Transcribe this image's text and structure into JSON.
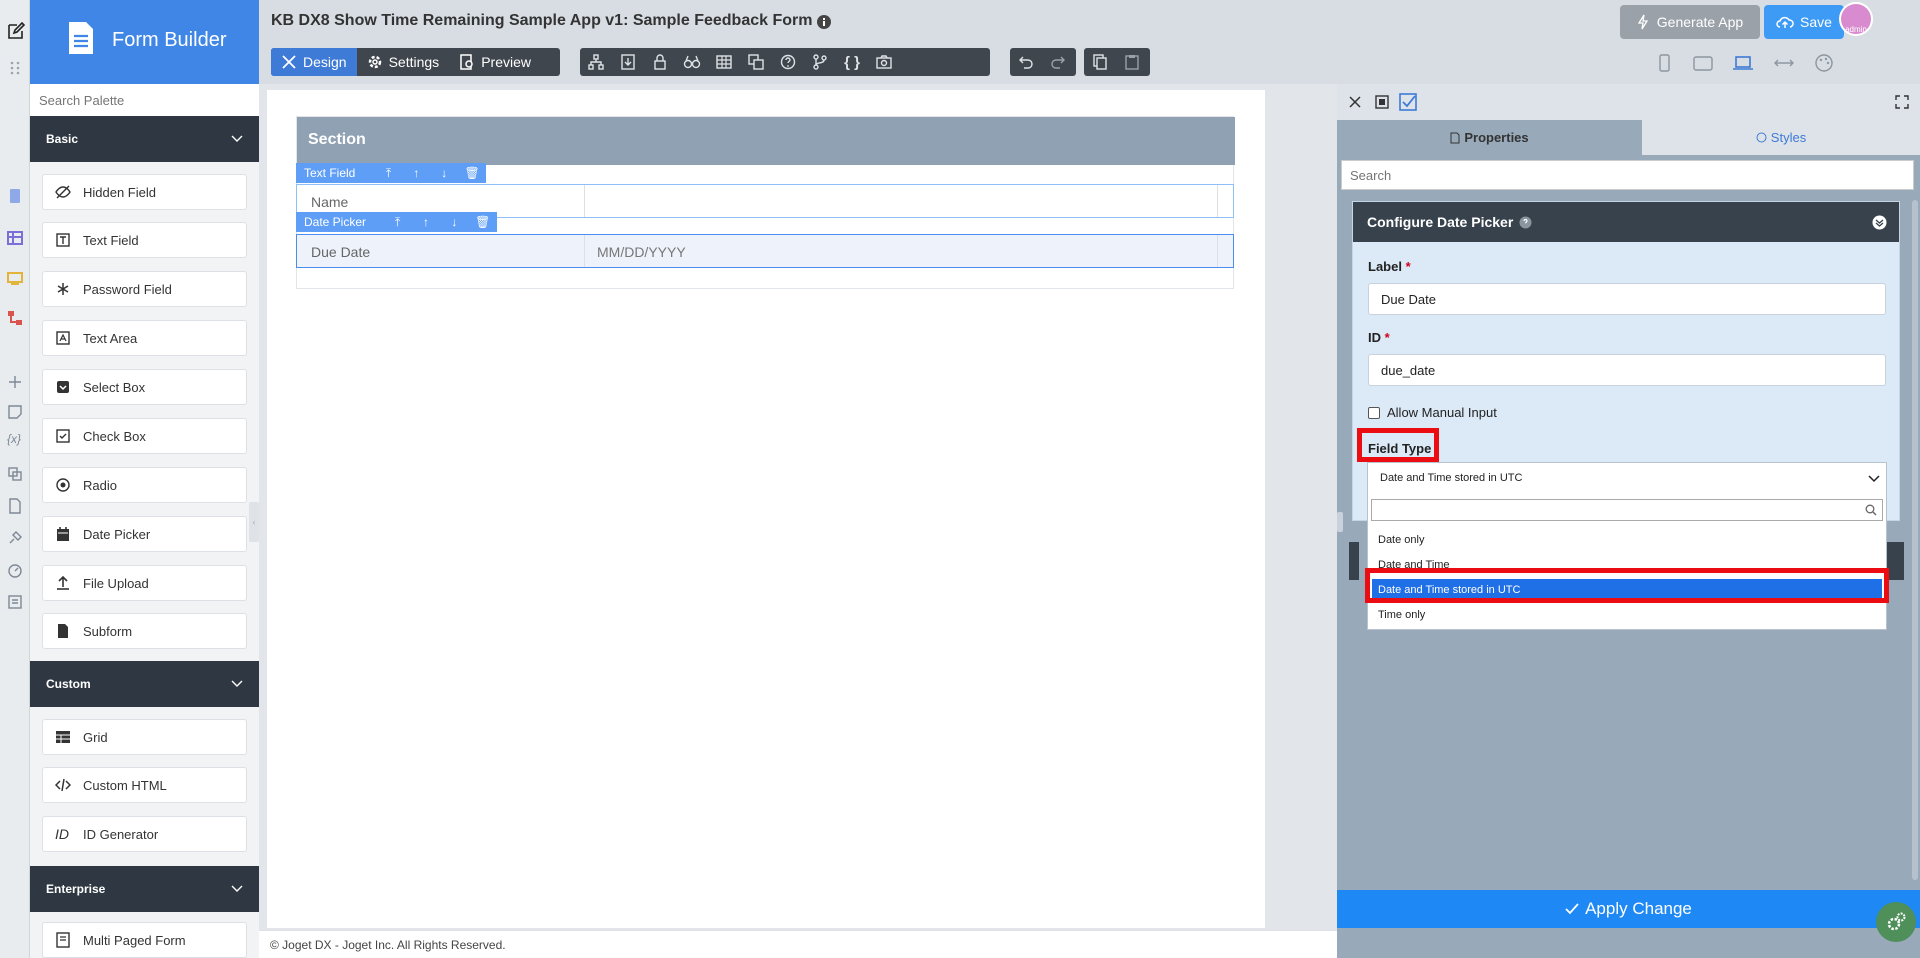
{
  "app": {
    "title": "KB DX8 Show Time Remaining Sample App v1: Sample Feedback Form",
    "builder_name": "Form Builder",
    "generate_app_label": "Generate App",
    "save_label": "Save",
    "avatar_text": "admin"
  },
  "toolbar": {
    "design_label": "Design",
    "settings_label": "Settings",
    "preview_label": "Preview",
    "tools": [
      "tree-icon",
      "import-icon",
      "lock-icon",
      "binoculars-icon",
      "table-icon",
      "translate-icon",
      "help-icon",
      "branch-icon",
      "code-icon",
      "camera-icon"
    ],
    "history": [
      "undo-icon",
      "redo-icon"
    ],
    "clipboard": [
      "copy-icon",
      "paste-icon"
    ],
    "devices": [
      "mobile-icon",
      "tablet-icon",
      "laptop-icon",
      "arrows-icon",
      "palette-icon"
    ]
  },
  "palette": {
    "search_placeholder": "Search Palette",
    "categories": [
      {
        "name": "Basic",
        "items": [
          "Hidden Field",
          "Text Field",
          "Password Field",
          "Text Area",
          "Select Box",
          "Check Box",
          "Radio",
          "Date Picker",
          "File Upload",
          "Subform"
        ]
      },
      {
        "name": "Custom",
        "items": [
          "Grid",
          "Custom HTML",
          "ID Generator"
        ]
      },
      {
        "name": "Enterprise",
        "items": [
          "Multi Paged Form"
        ]
      }
    ]
  },
  "canvas": {
    "section_title": "Section",
    "fields": [
      {
        "tag": "Text Field",
        "label": "Name",
        "value": ""
      },
      {
        "tag": "Date Picker",
        "label": "Due Date",
        "value": "MM/DD/YYYY"
      }
    ],
    "footer": "© Joget DX - Joget Inc. All Rights Reserved."
  },
  "properties": {
    "tabs": [
      "Properties",
      "Styles"
    ],
    "search_placeholder": "Search",
    "config_title": "Configure Date Picker",
    "label_label": "Label",
    "label_value": "Due Date",
    "id_label": "ID",
    "id_value": "due_date",
    "allow_manual_input": "Allow Manual Input",
    "allow_manual_checked": false,
    "field_type_label": "Field Type",
    "field_type_selected": "Date and Time stored in UTC",
    "field_type_options": [
      "Date only",
      "Date and Time",
      "Date and Time stored in UTC",
      "Time only"
    ],
    "apply_label": "Apply Change"
  },
  "colors": {
    "accent": "#3f86e6",
    "highlight": "#ec0d13",
    "dark": "#2f3842",
    "apply": "#1e88f5"
  }
}
